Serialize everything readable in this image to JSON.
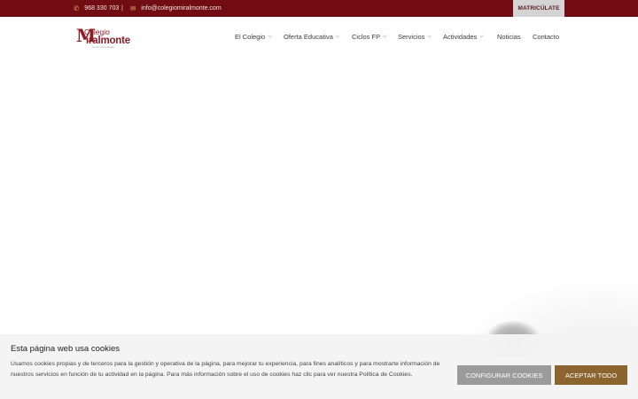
{
  "topbar": {
    "phone": "968 330 703",
    "separator": "|",
    "email": "info@colegiomiralmonte.com",
    "enroll_label": "MATRICÚLATE",
    "phone_icon": "phone-icon",
    "email_icon": "envelope-icon"
  },
  "logo": {
    "mark": "M",
    "line1": "Colegio",
    "line2": "iralmonte",
    "tagline": "Centro Concertado"
  },
  "nav": {
    "items": [
      {
        "label": "El Colegio",
        "dropdown": true
      },
      {
        "label": "Oferta Educativa",
        "dropdown": true
      },
      {
        "label": "Ciclos FP",
        "dropdown": true
      },
      {
        "label": "Servicios",
        "dropdown": true
      },
      {
        "label": "Actividades",
        "dropdown": true
      },
      {
        "label": "Noticias",
        "dropdown": false
      },
      {
        "label": "Contacto",
        "dropdown": false
      }
    ],
    "chevron": "⌵"
  },
  "cookie": {
    "title": "Esta página web usa cookies",
    "text": "Usamos cookies propias y de terceros para la gestión y operativa de la página, para mejorar tu experiencia, para fines analíticos y para mostrarte información de nuestros servicios en función de tu actividad en la página. Para más información sobre el uso de cookies haz clic para ver nuestra Política de Cookies.",
    "configure_label": "CONFIGURAR COOKIES",
    "accept_label": "ACEPTAR TODO"
  },
  "colors": {
    "topbar_bg": "#710d12",
    "brand": "#8e1b23",
    "accept_bg": "#8b6430",
    "configure_bg": "#9b9b9b",
    "icon_accent": "#e9b46b"
  }
}
